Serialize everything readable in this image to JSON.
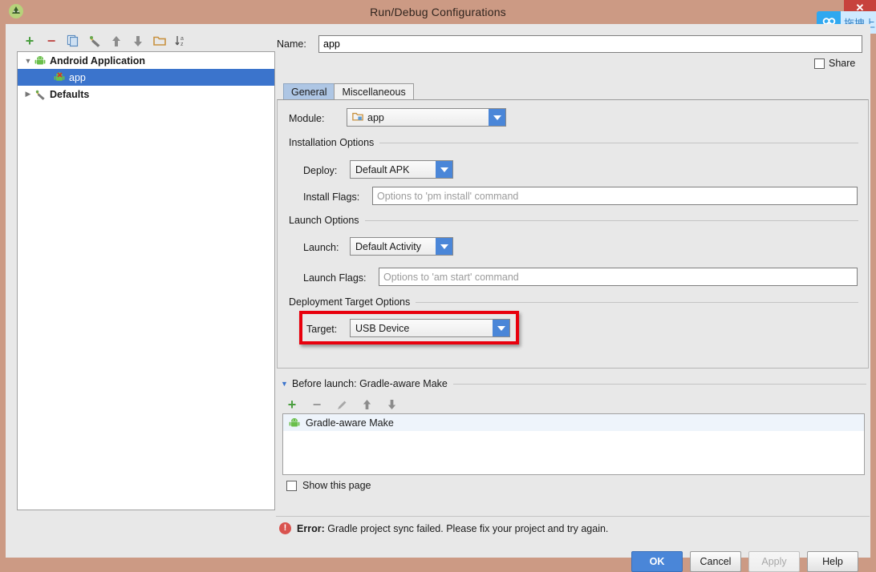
{
  "window": {
    "title": "Run/Debug Configurations",
    "app_icon": "android-studio-icon",
    "close_label": "✕"
  },
  "overlay_widget": {
    "icon": "baidu-netdisk-cloud-icon",
    "text": "拖拽上"
  },
  "left_panel": {
    "toolbar": [
      {
        "name": "add-configuration-button",
        "glyph": "+"
      },
      {
        "name": "remove-configuration-button",
        "glyph": "−"
      },
      {
        "name": "copy-configuration-button",
        "glyph": "copy-icon"
      },
      {
        "name": "edit-defaults-button",
        "glyph": "wrench-icon"
      },
      {
        "name": "move-up-button",
        "glyph": "↑"
      },
      {
        "name": "move-down-button",
        "glyph": "↓"
      },
      {
        "name": "move-into-folder-button",
        "glyph": "folder-icon"
      },
      {
        "name": "sort-configurations-button",
        "glyph": "sort-az-icon"
      }
    ],
    "tree": [
      {
        "label": "Android Application",
        "icon": "android-icon",
        "level": 1,
        "expanded": true,
        "selected": false,
        "bold": true
      },
      {
        "label": "app",
        "icon": "android-error-icon",
        "level": 2,
        "expanded": null,
        "selected": true,
        "bold": false
      },
      {
        "label": "Defaults",
        "icon": "wrench-icon",
        "level": 1,
        "expanded": false,
        "selected": false,
        "bold": true
      }
    ]
  },
  "name_field": {
    "label": "Name:",
    "value": "app",
    "placeholder": ""
  },
  "share": {
    "label": "Share",
    "checked": false
  },
  "tabs": [
    {
      "label": "General",
      "active": true
    },
    {
      "label": "Miscellaneous",
      "active": false
    }
  ],
  "general": {
    "module": {
      "label": "Module:",
      "value": "app",
      "icon": "module-folder-icon"
    },
    "installation_options": {
      "group_label": "Installation Options",
      "deploy": {
        "label": "Deploy:",
        "value": "Default APK"
      },
      "install_flags": {
        "label": "Install Flags:",
        "value": "",
        "placeholder": "Options to 'pm install' command"
      }
    },
    "launch_options": {
      "group_label": "Launch Options",
      "launch": {
        "label": "Launch:",
        "value": "Default Activity"
      },
      "launch_flags": {
        "label": "Launch Flags:",
        "value": "",
        "placeholder": "Options to 'am start' command"
      }
    },
    "deployment_target_options": {
      "group_label": "Deployment Target Options",
      "target": {
        "label": "Target:",
        "value": "USB Device"
      },
      "highlight_color": "#e8000d"
    }
  },
  "before_launch": {
    "header": "Before launch: Gradle-aware Make",
    "expanded": true,
    "toolbar": [
      {
        "name": "add-task-button",
        "glyph": "+"
      },
      {
        "name": "remove-task-button",
        "glyph": "−"
      },
      {
        "name": "edit-task-button",
        "glyph": "pencil-icon"
      },
      {
        "name": "move-task-up-button",
        "glyph": "↑"
      },
      {
        "name": "move-task-down-button",
        "glyph": "↓"
      }
    ],
    "tasks": [
      {
        "label": "Gradle-aware Make",
        "icon": "android-icon"
      }
    ],
    "show_this_page": {
      "label": "Show this page",
      "checked": false
    }
  },
  "error": {
    "prefix": "Error:",
    "message": "Gradle project sync failed. Please fix your project and try again.",
    "icon": "error-circle-icon",
    "color": "#d9534f"
  },
  "buttons": [
    {
      "label": "OK",
      "style": "primary",
      "name": "ok-button"
    },
    {
      "label": "Cancel",
      "style": "normal",
      "name": "cancel-button"
    },
    {
      "label": "Apply",
      "style": "disabled",
      "name": "apply-button"
    },
    {
      "label": "Help",
      "style": "normal",
      "name": "help-button"
    }
  ],
  "colors": {
    "titlebar": "#cc9a84",
    "dialog_bg": "#e8e8e8",
    "accent_blue": "#4a86d8",
    "selection_blue": "#3b74cc",
    "tab_active": "#aec6e4"
  }
}
